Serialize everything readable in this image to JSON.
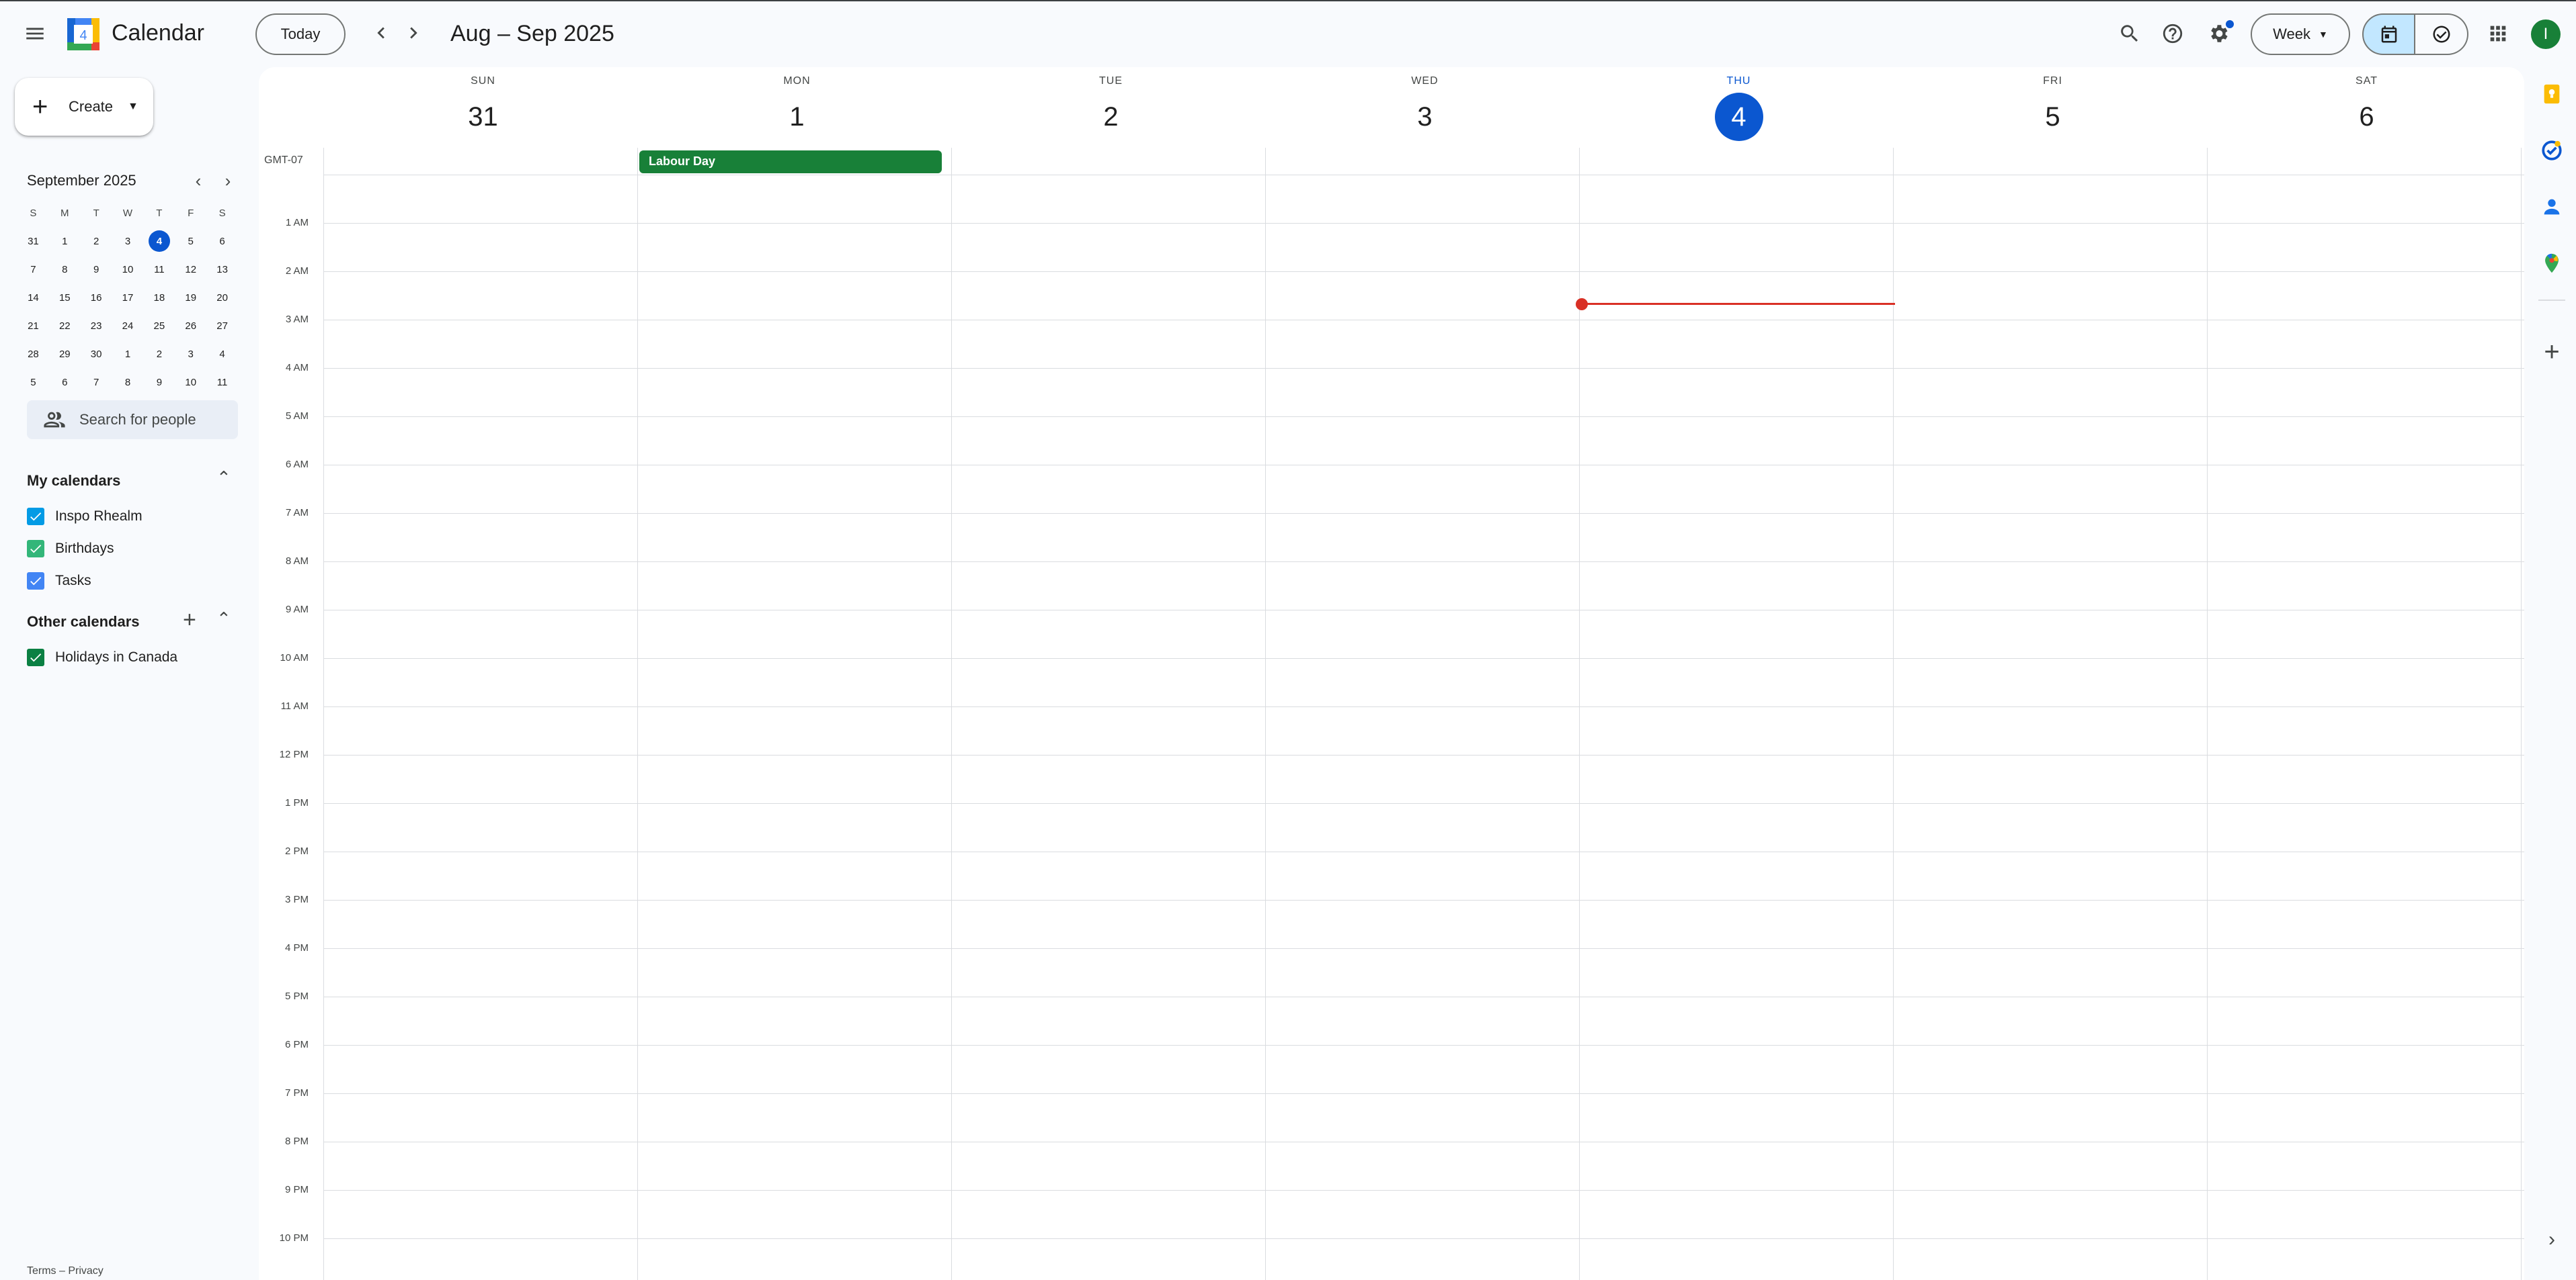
{
  "header": {
    "app_title": "Calendar",
    "logo_day": "4",
    "today_label": "Today",
    "date_range": "Aug – Sep 2025",
    "view_label": "Week",
    "avatar_letter": "I"
  },
  "sidebar": {
    "create_label": "Create",
    "mini_month_title": "September 2025",
    "weekday_initials": [
      "S",
      "M",
      "T",
      "W",
      "T",
      "F",
      "S"
    ],
    "mini_weeks": [
      [
        "31",
        "1",
        "2",
        "3",
        "4",
        "5",
        "6"
      ],
      [
        "7",
        "8",
        "9",
        "10",
        "11",
        "12",
        "13"
      ],
      [
        "14",
        "15",
        "16",
        "17",
        "18",
        "19",
        "20"
      ],
      [
        "21",
        "22",
        "23",
        "24",
        "25",
        "26",
        "27"
      ],
      [
        "28",
        "29",
        "30",
        "1",
        "2",
        "3",
        "4"
      ],
      [
        "5",
        "6",
        "7",
        "8",
        "9",
        "10",
        "11"
      ]
    ],
    "selected_day": "4",
    "search_people_placeholder": "Search for people",
    "my_calendars_title": "My calendars",
    "my_calendars": [
      {
        "label": "Inspo Rhealm",
        "color": "#039be5"
      },
      {
        "label": "Birthdays",
        "color": "#33b679"
      },
      {
        "label": "Tasks",
        "color": "#4285f4"
      }
    ],
    "other_calendars_title": "Other calendars",
    "other_calendars": [
      {
        "label": "Holidays in Canada",
        "color": "#0b8043"
      }
    ],
    "footer": "Terms – Privacy"
  },
  "week": {
    "timezone": "GMT-07",
    "days": [
      {
        "dow": "SUN",
        "num": "31"
      },
      {
        "dow": "MON",
        "num": "1"
      },
      {
        "dow": "TUE",
        "num": "2"
      },
      {
        "dow": "WED",
        "num": "3"
      },
      {
        "dow": "THU",
        "num": "4",
        "today": true
      },
      {
        "dow": "FRI",
        "num": "5"
      },
      {
        "dow": "SAT",
        "num": "6"
      }
    ],
    "all_day_events": [
      {
        "title": "Labour Day",
        "day": "MON",
        "color": "#188038"
      }
    ],
    "hours": [
      "1 AM",
      "2 AM",
      "3 AM",
      "4 AM",
      "5 AM",
      "6 AM",
      "7 AM",
      "8 AM",
      "9 AM",
      "10 AM",
      "11 AM",
      "12 PM",
      "1 PM",
      "2 PM",
      "3 PM",
      "4 PM",
      "5 PM",
      "6 PM",
      "7 PM",
      "8 PM",
      "9 PM",
      "10 PM"
    ]
  },
  "colors": {
    "accent": "#0b57d0",
    "now_indicator": "#d93025",
    "selected_view_bg": "#c2e7ff"
  },
  "icons": {
    "header": [
      "menu-icon",
      "search-icon",
      "help-icon",
      "settings-icon",
      "calendar-view-icon",
      "tasks-view-icon",
      "apps-grid-icon"
    ],
    "side_panel": [
      "keep-icon",
      "tasks-icon",
      "contacts-icon",
      "maps-icon",
      "add-icon",
      "expand-panel-icon"
    ]
  }
}
